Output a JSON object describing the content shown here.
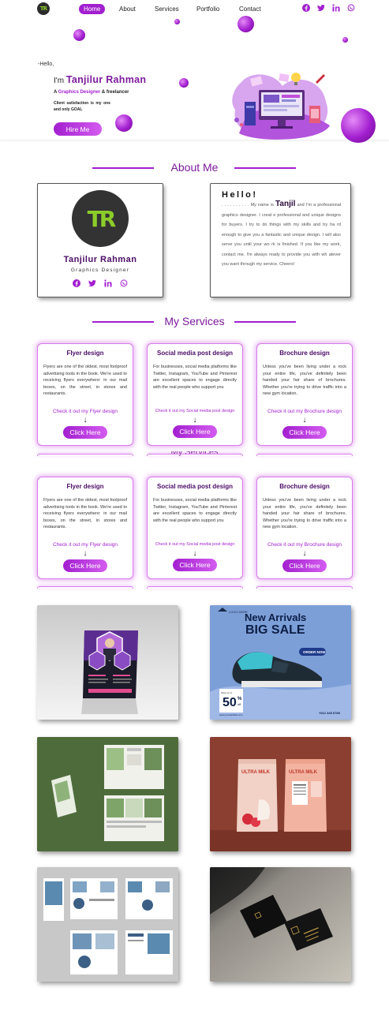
{
  "nav": {
    "logo_text": "TR",
    "items": [
      {
        "label": "Home",
        "active": true
      },
      {
        "label": "About"
      },
      {
        "label": "Services"
      },
      {
        "label": "Portfolio"
      },
      {
        "label": "Contact"
      }
    ],
    "social_icons": [
      "facebook-icon",
      "twitter-icon",
      "linkedin-icon",
      "whatsapp-icon"
    ]
  },
  "hero": {
    "greeting": "-Hello,",
    "intro_prefix": "I'm",
    "name": "Tanjilur Rahman",
    "role_prefix": "A",
    "role_highlight": "Graphics Designer",
    "role_suffix": "& freelancer",
    "goal": "Client satisfaction is my one and only GOAL",
    "hire_button": "Hire Me"
  },
  "about": {
    "title": "About Me",
    "logo_text": "TR",
    "name": "Tanjilur Rahman",
    "subtitle": "Graphics Designer",
    "hello": "Hello!",
    "text_prefix": ". . . . . . . . . . My name is",
    "text_name": "Tanjil",
    "text_body": "and I'm a professional graphics designer. I creat e professional and unique designs for buyers. I try to do things with my skills and try ha rd enough to give you a fantastic and unique design. I will also serve you until your wo rk is finished. If you like my work, contact me. I'm always ready to provide you with wh atever you want through my service. Cheers!"
  },
  "services": {
    "title": "My Services",
    "ghost_title": "My Services",
    "items": [
      {
        "title": "Flyer design",
        "desc": "Flyers are one of the oldest, most foolproof advertising tools in the book. We're used to receiving flyers everywhere: in our mail boxes, on the street, in stores and restaurants.",
        "link": "Check it out my Flyer design",
        "button": "Click Here"
      },
      {
        "title": "Social media post design",
        "desc": "For businesses, social media platforms like Twitter, Instagram, YouTube and Pinterest are excellent spaces to engage directly with the real people who support you",
        "link": "Check it out my Social media post design",
        "button": "Click Here"
      },
      {
        "title": "Brochure design",
        "desc": "Unless you've been living under a rock your entire life, you've definitely been handed your fair share of brochures. Whether you're trying to drive traffic into a new gym location.",
        "link": "Check it out my Brochure design",
        "button": "Click Here"
      }
    ]
  },
  "portfolio": {
    "items": [
      {
        "name": "flyer-mockup-image"
      },
      {
        "name": "sneaker-sale-post-image",
        "headline": "New Arrivals",
        "big": "BIG SALE",
        "cta": "ORDER NOW",
        "badge_top": "Save up to",
        "badge_num": "50",
        "badge_pct": "%",
        "badge_off": "off",
        "brand": "LOGO HERE",
        "phone": "+012 345 6789",
        "site": "www.yourwebsite.com"
      },
      {
        "name": "trifold-brochure-image"
      },
      {
        "name": "ultra-milk-pouch-image",
        "label1": "ULTRA MILK",
        "label2": "ULTRA MILK"
      },
      {
        "name": "brochure-pages-image"
      },
      {
        "name": "business-card-image"
      }
    ]
  },
  "colors": {
    "accent": "#a21fcf",
    "dark_purple": "#4a0c66",
    "logo_green": "#8ccc2a"
  }
}
